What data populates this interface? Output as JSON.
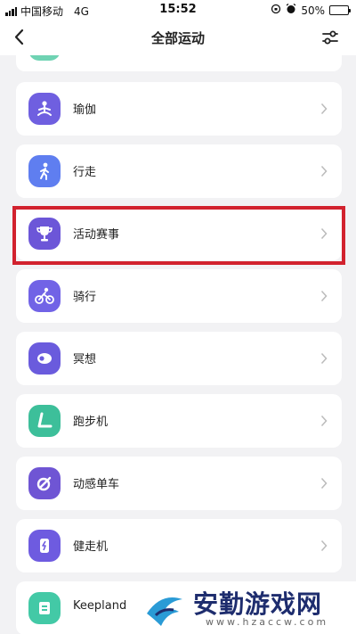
{
  "status_bar": {
    "carrier": "中国移动",
    "network": "4G",
    "time": "15:52",
    "battery": "50%",
    "battery_level": 0.5
  },
  "header": {
    "title": "全部运动"
  },
  "activities": [
    {
      "label": "",
      "icon": "partial-green-icon",
      "color": "#6fd3b3"
    },
    {
      "label": "瑜伽",
      "icon": "yoga-icon",
      "color": "#6f5fe0"
    },
    {
      "label": "行走",
      "icon": "walking-icon",
      "color": "#5f7ef0"
    },
    {
      "label": "活动赛事",
      "icon": "trophy-icon",
      "color": "#6c56d8"
    },
    {
      "label": "骑行",
      "icon": "cycling-icon",
      "color": "#7163e6",
      "highlighted": true
    },
    {
      "label": "冥想",
      "icon": "meditation-icon",
      "color": "#6a5bdd"
    },
    {
      "label": "跑步机",
      "icon": "treadmill-icon",
      "color": "#3dbf9a"
    },
    {
      "label": "动感单车",
      "icon": "spin-bike-icon",
      "color": "#6f55d4"
    },
    {
      "label": "健走机",
      "icon": "walking-machine-icon",
      "color": "#6e5be0"
    },
    {
      "label": "Keepland",
      "icon": "keepland-icon",
      "color": "#43c9a6"
    }
  ],
  "watermark": {
    "title": "安勤游戏网",
    "url": "www.hzaccw.com"
  },
  "colors": {
    "highlight_border": "#d2222e",
    "background": "#f2f2f4"
  }
}
